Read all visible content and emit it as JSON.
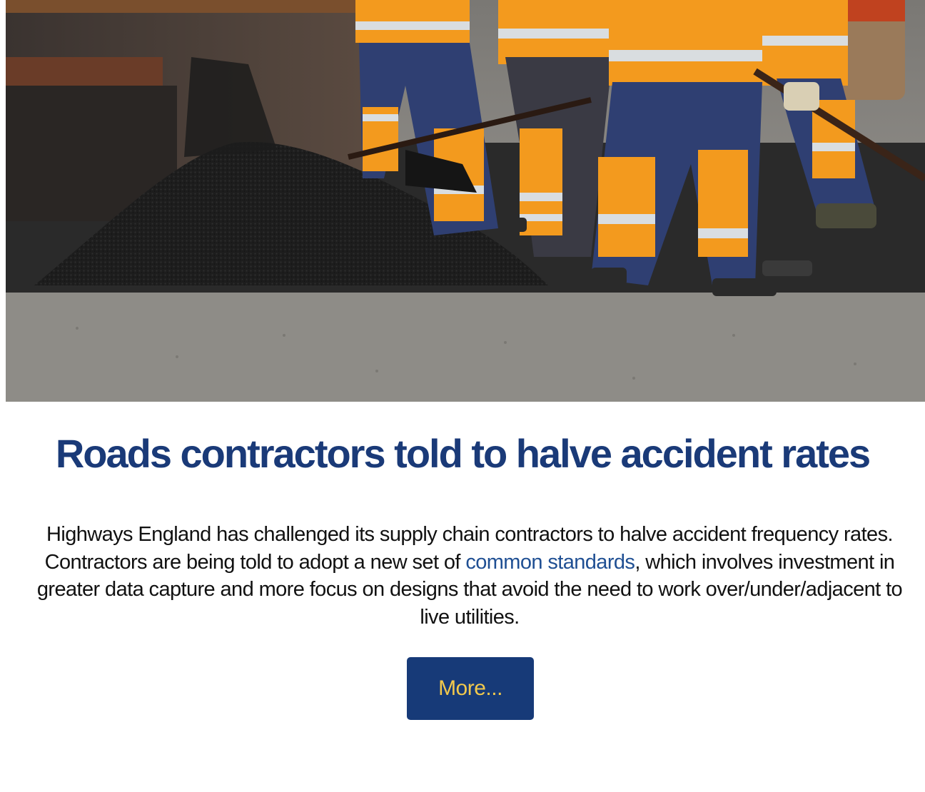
{
  "article": {
    "hero_image": {
      "icon": "roadworks-photo",
      "colors": {
        "hi_vis_orange": "#f39a1e",
        "reflective_stripe": "#d9dde0",
        "workwear_navy": "#2f3f72",
        "asphalt": "#202020",
        "road": "#8f8d88"
      }
    },
    "headline": "Roads contractors told to halve accident rates",
    "body": {
      "before_link": "Highways England has challenged its supply chain contractors to halve accident frequency rates. Contractors are being told to adopt a new set of ",
      "link_text": "common standards",
      "after_link": ", which involves investment in greater data capture and more focus on designs that avoid the need to work over/under/adjacent to live utilities."
    },
    "more_button": {
      "label": "More..."
    }
  },
  "colors": {
    "headline": "#1a3a78",
    "link": "#1f4f93",
    "button_bg": "#173a78",
    "button_text": "#f2c94c"
  }
}
